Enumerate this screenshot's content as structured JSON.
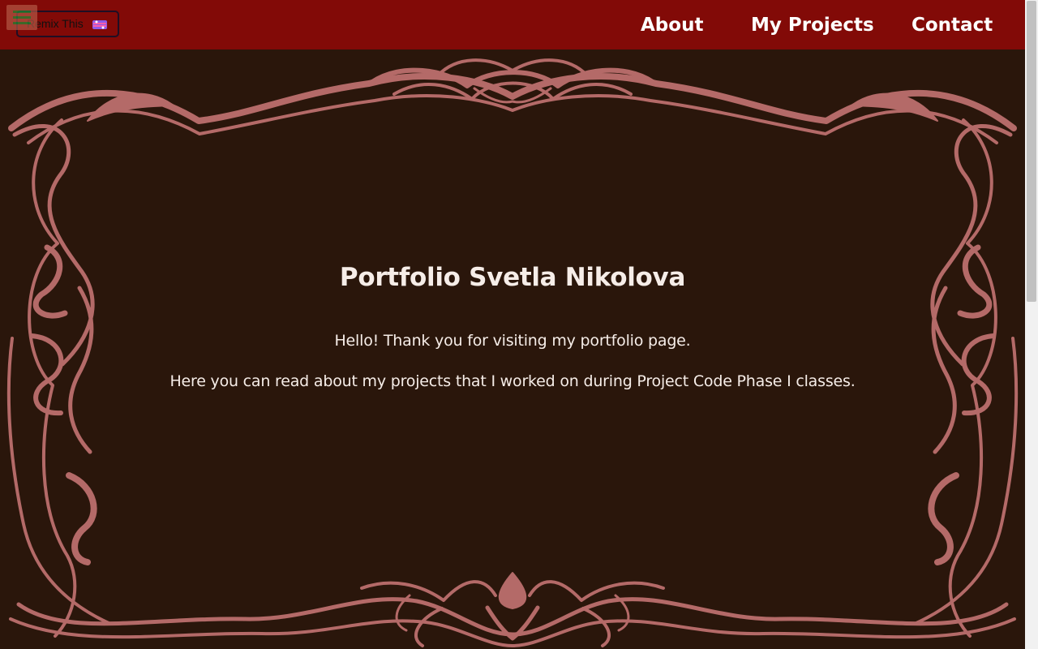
{
  "nav": {
    "remix_label": "Remix This",
    "links": [
      {
        "label": "About"
      },
      {
        "label": "My Projects"
      },
      {
        "label": "Contact"
      }
    ]
  },
  "hero": {
    "title": "Portfolio Svetla Nikolova",
    "paragraphs": [
      "Hello! Thank you for visiting my portfolio page.",
      "Here you can read about my projects that I worked on during Project Code Phase I classes."
    ]
  },
  "colors": {
    "navbar": "#820a07",
    "background": "#2a160b",
    "ornament": "#b46a68",
    "text": "#f6ede8"
  },
  "icons": {
    "menu": "hamburger-menu-icon",
    "remix": "remix-emoji-icon",
    "frame": "art-nouveau-frame-ornament"
  }
}
